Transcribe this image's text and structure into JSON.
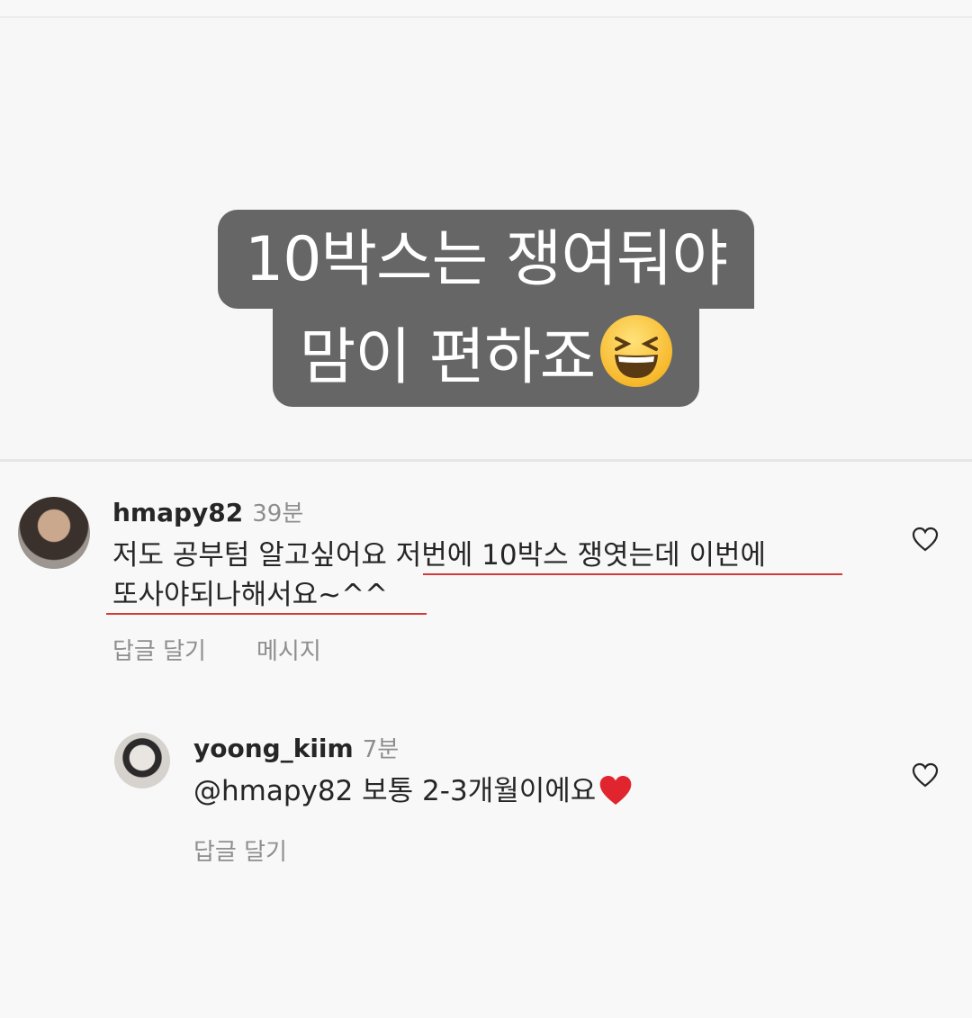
{
  "story": {
    "caption_line1": "10박스는 쟁여둬야",
    "caption_line2": "맘이 편하죠",
    "emoji": "grinning-squinting-face-emoji"
  },
  "comments": [
    {
      "username": "hmapy82",
      "time": "39분",
      "text_line1": "저도 공부텀 알고싶어요 저번에 10박스 쟁엿는데 이번에",
      "text_line2": "또사야되나해서요~^^",
      "reply_label": "답글 달기",
      "message_label": "메시지",
      "like_icon": "heart-outline-icon"
    },
    {
      "username": "yoong_kiim",
      "time": "7분",
      "text": "@hmapy82 보통 2-3개월이에요",
      "text_emoji": "red-heart-emoji",
      "reply_label": "답글 달기",
      "like_icon": "heart-outline-icon"
    }
  ],
  "colors": {
    "caption_bg": "#666666",
    "underline": "#d23b3b",
    "text": "#262626",
    "muted": "#8e8e8e"
  }
}
